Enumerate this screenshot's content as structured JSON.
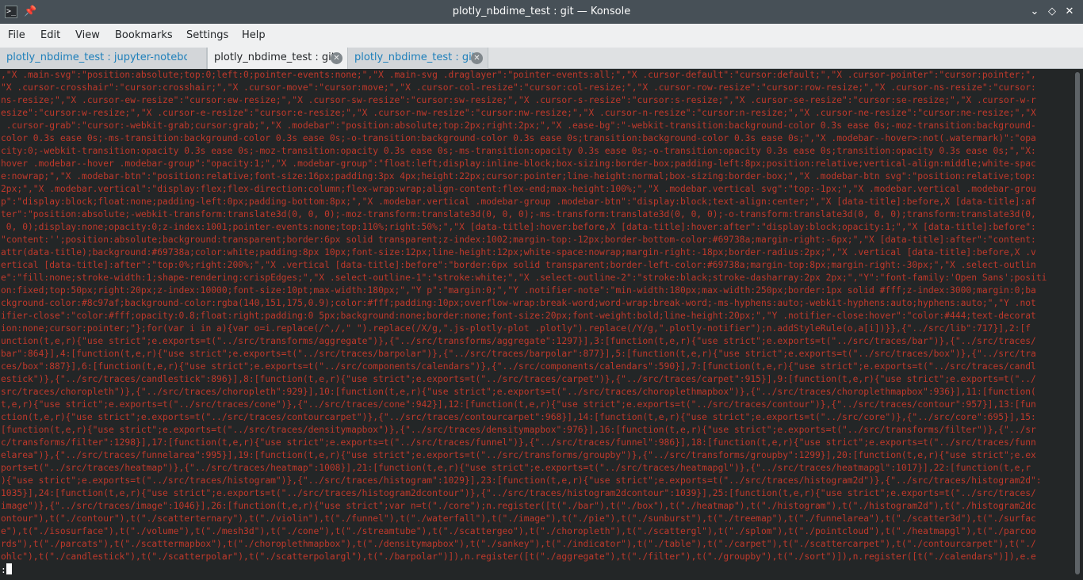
{
  "window": {
    "title": "plotly_nbdime_test : git — Konsole",
    "app_icon": "terminal-icon",
    "pin_icon": "pin-icon"
  },
  "menu": [
    "File",
    "Edit",
    "View",
    "Bookmarks",
    "Settings",
    "Help"
  ],
  "tabs": [
    {
      "label": "plotly_nbdime_test : jupyter-noteboo",
      "state": "inactive"
    },
    {
      "label": "plotly_nbdime_test : git",
      "state": "active"
    },
    {
      "label": "plotly_nbdime_test : git",
      "state": "inactive"
    }
  ],
  "terminal": {
    "text_color": "#c0392b",
    "lines": [
      ",\"X .main-svg\":\"position:absolute;top:0;left:0;pointer-events:none;\",\"X .main-svg .draglayer\":\"pointer-events:all;\",\"X .cursor-default\":\"cursor:default;\",\"X .cursor-pointer\":\"cursor:pointer;\",",
      "\"X .cursor-crosshair\":\"cursor:crosshair;\",\"X .cursor-move\":\"cursor:move;\",\"X .cursor-col-resize\":\"cursor:col-resize;\",\"X .cursor-row-resize\":\"cursor:row-resize;\",\"X .cursor-ns-resize\":\"cursor:",
      "ns-resize;\",\"X .cursor-ew-resize\":\"cursor:ew-resize;\",\"X .cursor-sw-resize\":\"cursor:sw-resize;\",\"X .cursor-s-resize\":\"cursor:s-resize;\",\"X .cursor-se-resize\":\"cursor:se-resize;\",\"X .cursor-w-r",
      "esize\":\"cursor:w-resize;\",\"X .cursor-e-resize\":\"cursor:e-resize;\",\"X .cursor-nw-resize\":\"cursor:nw-resize;\",\"X .cursor-n-resize\":\"cursor:n-resize;\",\"X .cursor-ne-resize\":\"cursor:ne-resize;\",\"X",
      " .cursor-grab\":\"cursor:-webkit-grab;cursor:grab;\",\"X .modebar\":\"position:absolute;top:2px;right:2px;\",\"X .ease-bg\":\"-webkit-transition:background-color 0.3s ease 0s;-moz-transition:background-",
      "color 0.3s ease 0s;-ms-transition:background-color 0.3s ease 0s;-o-transition:background-color 0.3s ease 0s;transition:background-color 0.3s ease 0s;\",\"X .modebar--hover>:not(.watermark)\":\"opa",
      "city:0;-webkit-transition:opacity 0.3s ease 0s;-moz-transition:opacity 0.3s ease 0s;-ms-transition:opacity 0.3s ease 0s;-o-transition:opacity 0.3s ease 0s;transition:opacity 0.3s ease 0s;\",\"X:",
      "hover .modebar--hover .modebar-group\":\"opacity:1;\",\"X .modebar-group\":\"float:left;display:inline-block;box-sizing:border-box;padding-left:8px;position:relative;vertical-align:middle;white-spac",
      "e:nowrap;\",\"X .modebar-btn\":\"position:relative;font-size:16px;padding:3px 4px;height:22px;cursor:pointer;line-height:normal;box-sizing:border-box;\",\"X .modebar-btn svg\":\"position:relative;top:",
      "2px;\",\"X .modebar.vertical\":\"display:flex;flex-direction:column;flex-wrap:wrap;align-content:flex-end;max-height:100%;\",\"X .modebar.vertical svg\":\"top:-1px;\",\"X .modebar.vertical .modebar-grou",
      "p\":\"display:block;float:none;padding-left:0px;padding-bottom:8px;\",\"X .modebar.vertical .modebar-group .modebar-btn\":\"display:block;text-align:center;\",\"X [data-title]:before,X [data-title]:af",
      "ter\":\"position:absolute;-webkit-transform:translate3d(0, 0, 0);-moz-transform:translate3d(0, 0, 0);-ms-transform:translate3d(0, 0, 0);-o-transform:translate3d(0, 0, 0);transform:translate3d(0,",
      " 0, 0);display:none;opacity:0;z-index:1001;pointer-events:none;top:110%;right:50%;\",\"X [data-title]:hover:before,X [data-title]:hover:after\":\"display:block;opacity:1;\",\"X [data-title]:before\":",
      "\"content:'';position:absolute;background:transparent;border:6px solid transparent;z-index:1002;margin-top:-12px;border-bottom-color:#69738a;margin-right:-6px;\",\"X [data-title]:after\":\"content:",
      "attr(data-title);background:#69738a;color:white;padding:8px 10px;font-size:12px;line-height:12px;white-space:nowrap;margin-right:-18px;border-radius:2px;\",\"X .vertical [data-title]:before,X .v",
      "ertical [data-title]:after\":\"top:0%;right:200%;\",\"X .vertical [data-title]:before\":\"border:6px solid transparent;border-left-color:#69738a;margin-top:8px;margin-right:-30px;\",\"X .select-outlin",
      "e\":\"fill:none;stroke-width:1;shape-rendering:crispEdges;\",\"X .select-outline-1\":\"stroke:white;\",\"X .select-outline-2\":\"stroke:black;stroke-dasharray:2px 2px;\",\"Y\":\"font-family:'Open Sans';positi",
      "on:fixed;top:50px;right:20px;z-index:10000;font-size:10pt;max-width:180px;\",\"Y p\":\"margin:0;\",\"Y .notifier-note\":\"min-width:180px;max-width:250px;border:1px solid #fff;z-index:3000;margin:0;ba",
      "ckground-color:#8c97af;background-color:rgba(140,151,175,0.9);color:#fff;padding:10px;overflow-wrap:break-word;word-wrap:break-word;-ms-hyphens:auto;-webkit-hyphens:auto;hyphens:auto;\",\"Y .not",
      "ifier-close\":\"color:#fff;opacity:0.8;float:right;padding:0 5px;background:none;border:none;font-size:20px;font-weight:bold;line-height:20px;\",\"Y .notifier-close:hover\":\"color:#444;text-decorat",
      "ion:none;cursor:pointer;\"};for(var i in a){var o=i.replace(/^,/,\" \").replace(/X/g,\".js-plotly-plot .plotly\").replace(/Y/g,\".plotly-notifier\");n.addStyleRule(o,a[i])}},{\"../src/lib\":717}],2:[f",
      "unction(t,e,r){\"use strict\";e.exports=t(\"../src/transforms/aggregate\")},{\"../src/transforms/aggregate\":1297}],3:[function(t,e,r){\"use strict\";e.exports=t(\"../src/traces/bar\")},{\"../src/traces/",
      "bar\":864}],4:[function(t,e,r){\"use strict\";e.exports=t(\"../src/traces/barpolar\")},{\"../src/traces/barpolar\":877}],5:[function(t,e,r){\"use strict\";e.exports=t(\"../src/traces/box\")},{\"../src/tra",
      "ces/box\":887}],6:[function(t,e,r){\"use strict\";e.exports=t(\"../src/components/calendars\")},{\"../src/components/calendars\":590}],7:[function(t,e,r){\"use strict\";e.exports=t(\"../src/traces/candl",
      "estick\")},{\"../src/traces/candlestick\":896}],8:[function(t,e,r){\"use strict\";e.exports=t(\"../src/traces/carpet\")},{\"../src/traces/carpet\":915}],9:[function(t,e,r){\"use strict\";e.exports=t(\"../",
      "src/traces/choropleth\")},{\"../src/traces/choropleth\":929}],10:[function(t,e,r){\"use strict\";e.exports=t(\"../src/traces/choroplethmapbox\")},{\"../src/traces/choroplethmapbox\":936}],11:[function(",
      "t,e,r){\"use strict\";e.exports=t(\"../src/traces/cone\")},{\"../src/traces/cone\":942}],12:[function(t,e,r){\"use strict\";e.exports=t(\"../src/traces/contour\")},{\"../src/traces/contour\":957}],13:[fun",
      "ction(t,e,r){\"use strict\";e.exports=t(\"../src/traces/contourcarpet\")},{\"../src/traces/contourcarpet\":968}],14:[function(t,e,r){\"use strict\";e.exports=t(\"../src/core\")},{\"../src/core\":695}],15:",
      "[function(t,e,r){\"use strict\";e.exports=t(\"../src/traces/densitymapbox\")},{\"../src/traces/densitymapbox\":976}],16:[function(t,e,r){\"use strict\";e.exports=t(\"../src/transforms/filter\")},{\"../sr",
      "c/transforms/filter\":1298}],17:[function(t,e,r){\"use strict\";e.exports=t(\"../src/traces/funnel\")},{\"../src/traces/funnel\":986}],18:[function(t,e,r){\"use strict\";e.exports=t(\"../src/traces/funn",
      "elarea\")},{\"../src/traces/funnelarea\":995}],19:[function(t,e,r){\"use strict\";e.exports=t(\"../src/transforms/groupby\")},{\"../src/transforms/groupby\":1299}],20:[function(t,e,r){\"use strict\";e.ex",
      "ports=t(\"../src/traces/heatmap\")},{\"../src/traces/heatmap\":1008}],21:[function(t,e,r){\"use strict\";e.exports=t(\"../src/traces/heatmapgl\")},{\"../src/traces/heatmapgl\":1017}],22:[function(t,e,r",
      "){\"use strict\";e.exports=t(\"../src/traces/histogram\")},{\"../src/traces/histogram\":1029}],23:[function(t,e,r){\"use strict\";e.exports=t(\"../src/traces/histogram2d\")},{\"../src/traces/histogram2d\":",
      "1035}],24:[function(t,e,r){\"use strict\";e.exports=t(\"../src/traces/histogram2dcontour\")},{\"../src/traces/histogram2dcontour\":1039}],25:[function(t,e,r){\"use strict\";e.exports=t(\"../src/traces/",
      "image\")},{\"../src/traces/image\":1046}],26:[function(t,e,r){\"use strict\";var n=t(\"./core\");n.register([t(\"./bar\"),t(\"./box\"),t(\"./heatmap\"),t(\"./histogram\"),t(\"./histogram2d\"),t(\"./histogram2dc",
      "ontour\"),t(\"./contour\"),t(\"./scatterternary\"),t(\"./violin\"),t(\"./funnel\"),t(\"./waterfall\"),t(\"./image\"),t(\"./pie\"),t(\"./sunburst\"),t(\"./treemap\"),t(\"./funnelarea\"),t(\"./scatter3d\"),t(\"./surfac",
      "e\"),t(\"./isosurface\"),t(\"./volume\"),t(\"./mesh3d\"),t(\"./cone\"),t(\"./streamtube\"),t(\"./scattergeo\"),t(\"./choropleth\"),t(\"./scattergl\"),t(\"./splom\"),t(\"./pointcloud\"),t(\"./heatmapgl\"),t(\"./parcoo",
      "rds\"),t(\"./parcats\"),t(\"./scattermapbox\"),t(\"./choroplethmapbox\"),t(\"./densitymapbox\"),t(\"./sankey\"),t(\"./indicator\"),t(\"./table\"),t(\"./carpet\"),t(\"./scattercarpet\"),t(\"./contourcarpet\"),t(\"./",
      "ohlc\"),t(\"./candlestick\"),t(\"./scatterpolar\"),t(\"./scatterpolargl\"),t(\"./barpolar\")]),n.register([t(\"./aggregate\"),t(\"./filter\"),t(\"./groupby\"),t(\"./sort\")]),n.register([t(\"./calendars\")]),e.e"
    ],
    "prompt": ":"
  }
}
